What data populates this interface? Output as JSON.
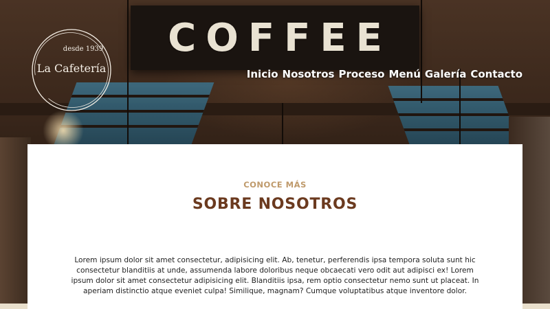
{
  "background": {
    "sign_text": "COFFEE"
  },
  "brand": {
    "tagline": "desde 1939",
    "name": "La Cafetería"
  },
  "nav": {
    "items": [
      {
        "label": "Inicio"
      },
      {
        "label": "Nosotros"
      },
      {
        "label": "Proceso"
      },
      {
        "label": "Menú"
      },
      {
        "label": "Galería"
      },
      {
        "label": "Contacto"
      }
    ]
  },
  "about": {
    "eyebrow": "CONOCE MÁS",
    "title": "SOBRE NOSOTROS",
    "body": "Lorem ipsum dolor sit amet consectetur, adipisicing elit. Ab, tenetur, perferendis ipsa tempora soluta sunt hic consectetur blanditiis at unde, assumenda labore doloribus neque obcaecati vero odit aut adipisci ex! Lorem ipsum dolor sit amet consectetur adipisicing elit. Blanditiis ipsa, rem optio consectetur nemo sunt ut placeat. In aperiam distinctio atque eveniet culpa! Similique, magnam? Cumque voluptatibus atque inventore dolor."
  },
  "colors": {
    "accent_gold": "#bf9a6b",
    "heading_brown": "#6b3a1f",
    "card_bg": "#ffffff",
    "nav_text": "#ffffff"
  }
}
